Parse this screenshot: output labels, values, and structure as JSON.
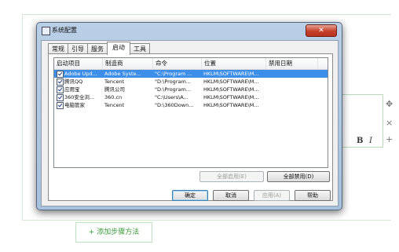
{
  "window": {
    "title": "系统配置",
    "close_glyph": "✕"
  },
  "tabs": [
    {
      "label": "常规"
    },
    {
      "label": "引导"
    },
    {
      "label": "服务"
    },
    {
      "label": "启动"
    },
    {
      "label": "工具"
    }
  ],
  "startup_list": {
    "columns": [
      "启动项目",
      "制造商",
      "命令",
      "位置",
      "禁用日期"
    ],
    "rows": [
      {
        "item": "Adobe Upd...",
        "maker": "Adobe Syste...",
        "command": "\"C:\\Program ...",
        "location": "HKLM\\SOFTWARE\\M...",
        "disabled_date": "",
        "checked": true
      },
      {
        "item": "腾讯QQ",
        "maker": "Tencent",
        "command": "\"D:\\Program...",
        "location": "HKLM\\SOFTWARE\\M...",
        "disabled_date": "",
        "checked": true
      },
      {
        "item": "应用宝",
        "maker": "腾讯公司",
        "command": "\"D:\\Program...",
        "location": "HKLM\\SOFTWARE\\M...",
        "disabled_date": "",
        "checked": true
      },
      {
        "item": "360安全浏...",
        "maker": "360.cn",
        "command": "\"C:\\Users\\A...",
        "location": "HKLM\\SOFTWARE\\M...",
        "disabled_date": "",
        "checked": true
      },
      {
        "item": "电脑管家",
        "maker": "Tencent",
        "command": "\"D:\\360Down...",
        "location": "HKLM\\SOFTWARE\\M...",
        "disabled_date": "",
        "checked": true
      }
    ]
  },
  "panel_buttons": {
    "enable_all": "全部启用(E)",
    "disable_all": "全部禁用(D)"
  },
  "dialog_buttons": {
    "ok": "确定",
    "cancel": "取消",
    "apply": "应用(A)",
    "help": "帮助"
  },
  "background": {
    "add_step": "+ 添加步骤方法",
    "bold": "B",
    "italic": "I",
    "move_glyph": "✥",
    "delete_glyph": "×",
    "add_glyph": "+"
  }
}
